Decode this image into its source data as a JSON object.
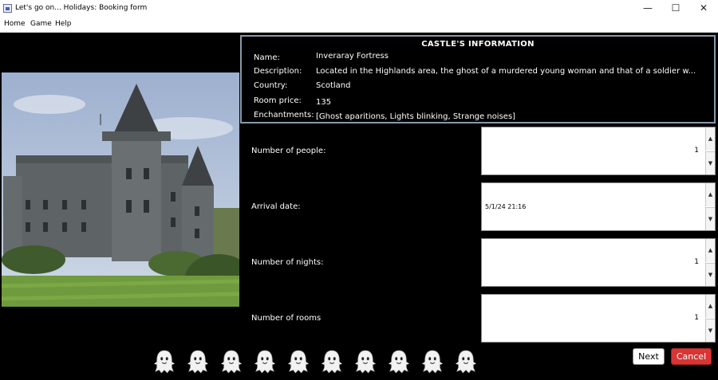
{
  "window": {
    "title": "Let's go on... Holidays: Booking form",
    "minimize": "—",
    "maximize": "☐",
    "close": "✕"
  },
  "menu": {
    "items": [
      "Home",
      "Game",
      "Help"
    ]
  },
  "castle": {
    "heading": "CASTLE'S INFORMATION",
    "labels": {
      "name": "Name:",
      "description": "Description:",
      "country": "Country:",
      "price": "Room price:",
      "enchantments": "Enchantments:"
    },
    "values": {
      "name": "Inveraray Fortress",
      "description": "Located in the Highlands area, the ghost of a murdered young woman and that of a soldier w...",
      "country": "Scotland",
      "price": "135",
      "enchantments": "[Ghost aparitions, Lights blinking, Strange noises]"
    }
  },
  "form": {
    "people": {
      "label": "Number of people:",
      "value": "1"
    },
    "arrival": {
      "label": "Arrival date:",
      "value": "5/1/24 21:16"
    },
    "nights": {
      "label": "Number of nights:",
      "value": "1"
    },
    "rooms": {
      "label": "Number of rooms",
      "value": "1"
    }
  },
  "spinner_arrows": {
    "up": "▲",
    "down": "▼"
  },
  "buttons": {
    "next": "Next",
    "cancel": "Cancel"
  },
  "colors": {
    "background": "#000000",
    "cancel": "#d93535",
    "info_border": "#8899aa"
  },
  "icons": {
    "ghost": "ghost-icon",
    "castle_photo": "castle-photo"
  }
}
